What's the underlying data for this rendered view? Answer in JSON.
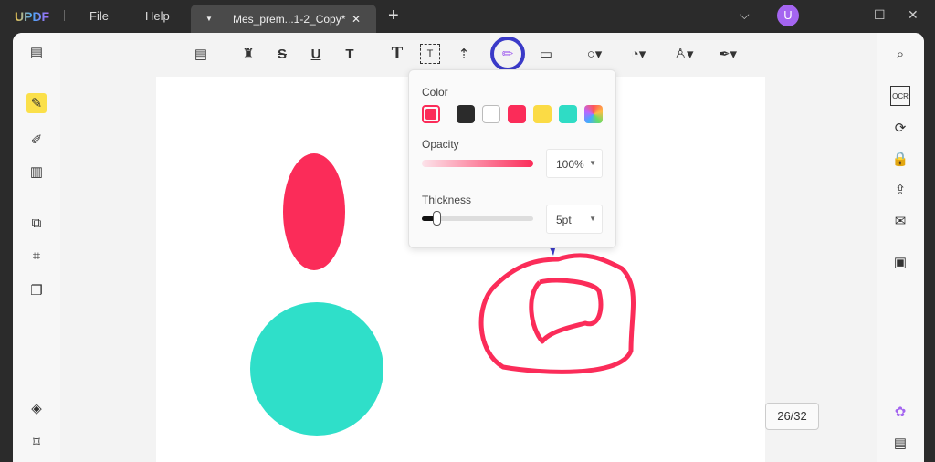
{
  "app": {
    "logo": "UPDF",
    "menu": [
      "File",
      "Help"
    ],
    "tab_title": "Mes_prem...1-2_Copy*",
    "avatar": "U"
  },
  "popup": {
    "color_label": "Color",
    "colors": [
      "#2b2b2b",
      "#ffffff",
      "#fb2c59",
      "#fbdb45",
      "#2fdcc5"
    ],
    "selected_color": "#fb2c59",
    "opacity_label": "Opacity",
    "opacity": "100%",
    "thickness_label": "Thickness",
    "thickness": "5pt",
    "thickness_fraction": 0.1
  },
  "page_indicator": "26/32",
  "colors": {
    "accent": "#3a3ac8",
    "ellipse": "#fb2c59",
    "circle": "#2fdfc9"
  }
}
